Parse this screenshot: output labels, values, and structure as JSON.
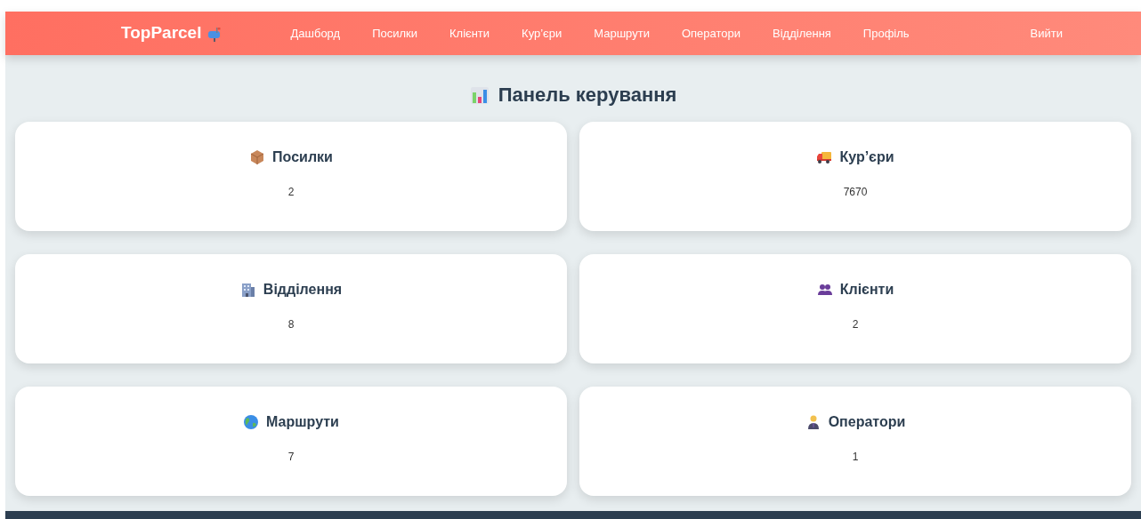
{
  "brand": {
    "name": "TopParcel"
  },
  "nav": [
    {
      "label": "Дашборд",
      "kind": "link"
    },
    {
      "label": "Посилки",
      "kind": "link"
    },
    {
      "label": "Клієнти",
      "kind": "link"
    },
    {
      "label": "Кур’єри",
      "kind": "link"
    },
    {
      "label": "Маршрути",
      "kind": "link"
    },
    {
      "label": "Оператори",
      "kind": "link"
    },
    {
      "label": "Відділення",
      "kind": "link"
    },
    {
      "label": "Профіль",
      "kind": "link"
    },
    {
      "label": "Вийти",
      "kind": "logout"
    }
  ],
  "page_title": "Панель керування",
  "cards": [
    {
      "kind": "box",
      "title": "Посилки",
      "value": "2"
    },
    {
      "kind": "truck",
      "title": "Кур’єри",
      "value": "7670"
    },
    {
      "kind": "building",
      "title": "Відділення",
      "value": "8"
    },
    {
      "kind": "people",
      "title": "Клієнти",
      "value": "2"
    },
    {
      "kind": "globe",
      "title": "Маршрути",
      "value": "7"
    },
    {
      "kind": "person",
      "title": "Оператори",
      "value": "1"
    }
  ]
}
